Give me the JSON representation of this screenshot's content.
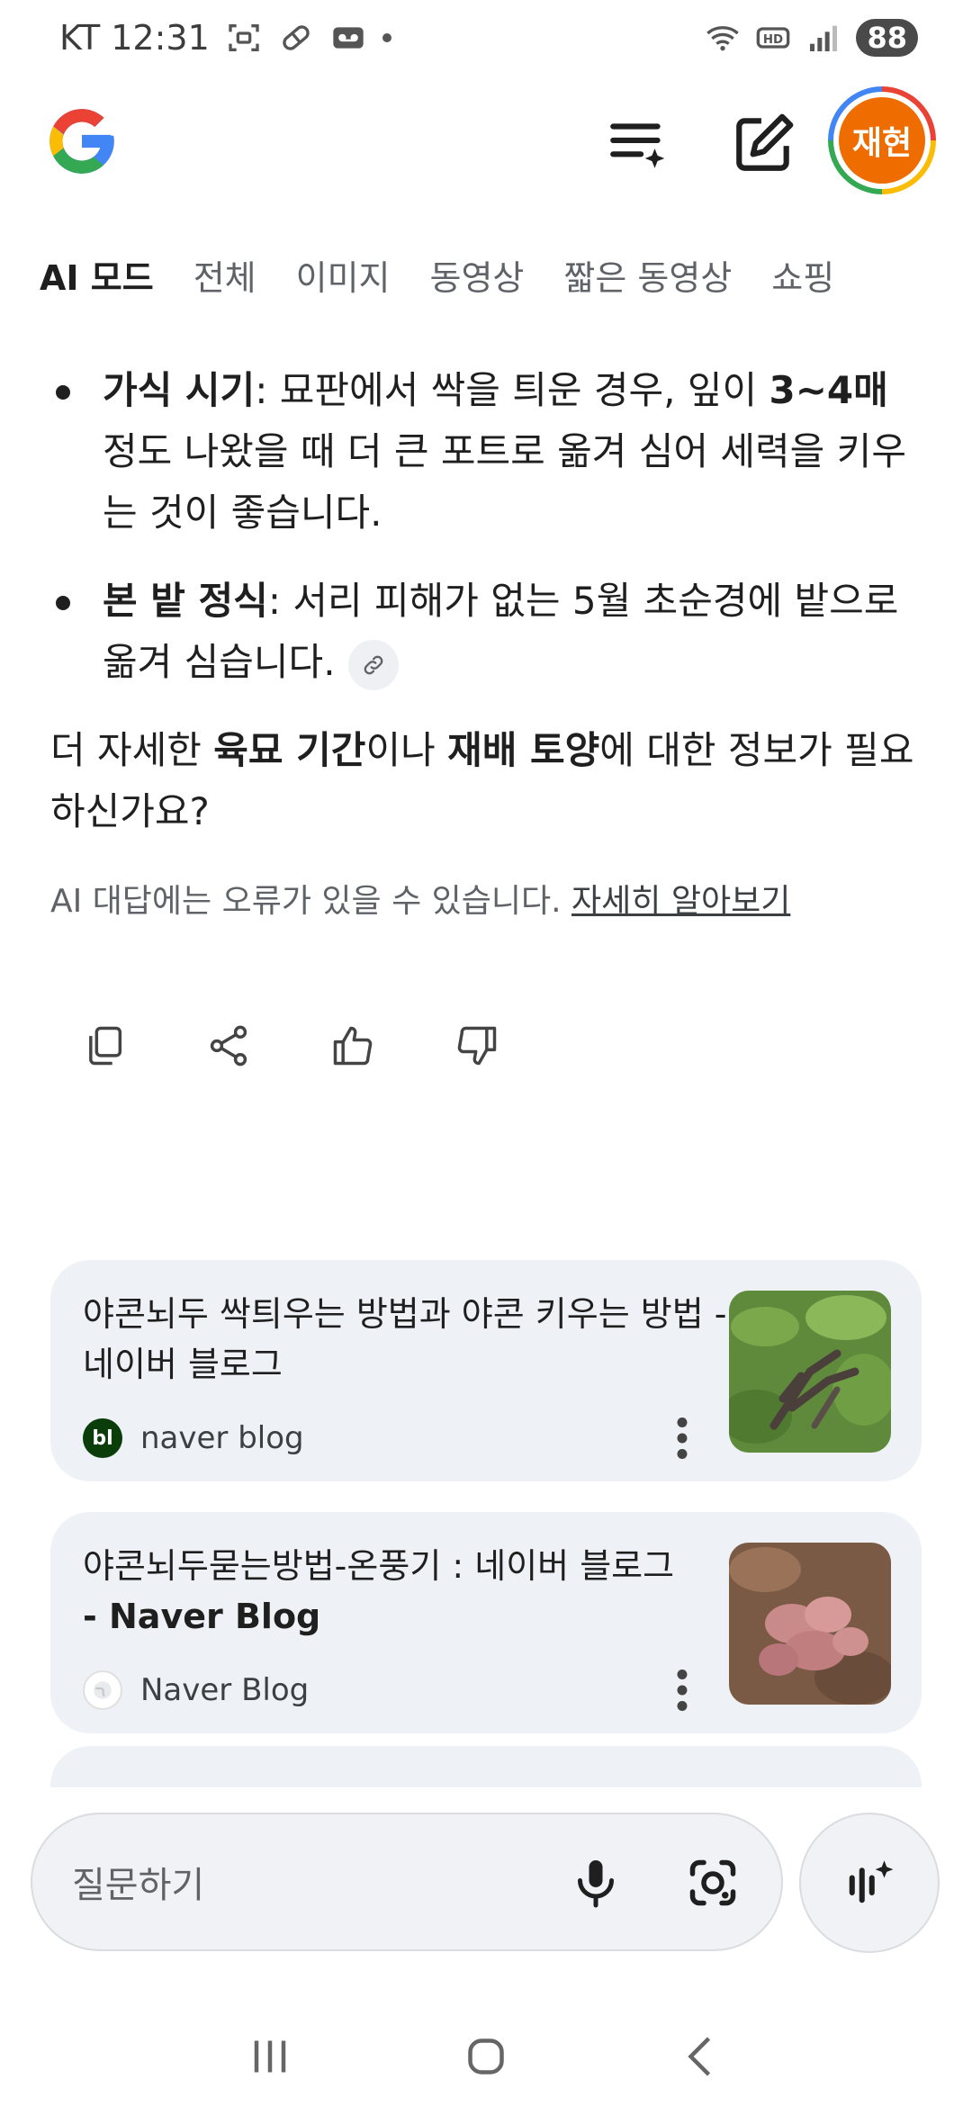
{
  "status_bar": {
    "carrier_time": "KT 12:31",
    "battery": "88"
  },
  "header": {
    "avatar_text": "재현"
  },
  "tabs": [
    {
      "label": "AI 모드"
    },
    {
      "label": "전체"
    },
    {
      "label": "이미지"
    },
    {
      "label": "동영상"
    },
    {
      "label": "짧은 동영상"
    },
    {
      "label": "쇼핑"
    }
  ],
  "answer": {
    "bullet1": {
      "term": "가식 시기",
      "text_a": ": 묘판에서 싹을 틔운 경우, 잎이 ",
      "bold": "3~4매",
      "text_b": " 정도 나왔을 때 더 큰 포트로 옮겨 심어 세력을 키우는 것이 좋습니다."
    },
    "bullet2": {
      "term": "본 밭 정식",
      "text": ": 서리 피해가 없는 5월 초순경에 밭으로 옮겨 심습니다."
    },
    "followup": {
      "a": "더 자세한 ",
      "b": "육묘 기간",
      "c": "이나 ",
      "d": "재배 토양",
      "e": "에 대한 정보가 필요하신가요?"
    },
    "disclaimer": "AI 대답에는 오류가 있을 수 있습니다.",
    "learn_more": "자세히 알아보기"
  },
  "sources": [
    {
      "title": "야콘뇌두 싹틔우는 방법과 야콘 키우는 방법 - 네이버 블로그",
      "source": "naver blog",
      "favicon_text": "bl",
      "favicon_color": "#0b3d0b",
      "thumb": "green-plant"
    },
    {
      "title_a": "야콘뇌두묻는방법-온풍기 : 네이버 블로그",
      "title_b": "- Naver Blog",
      "source": "Naver Blog",
      "thumb": "pink-tubers"
    }
  ],
  "input": {
    "placeholder": "질문하기"
  },
  "colors": {
    "accent_orange": "#ef6c00",
    "card_bg": "#eef1f6"
  }
}
